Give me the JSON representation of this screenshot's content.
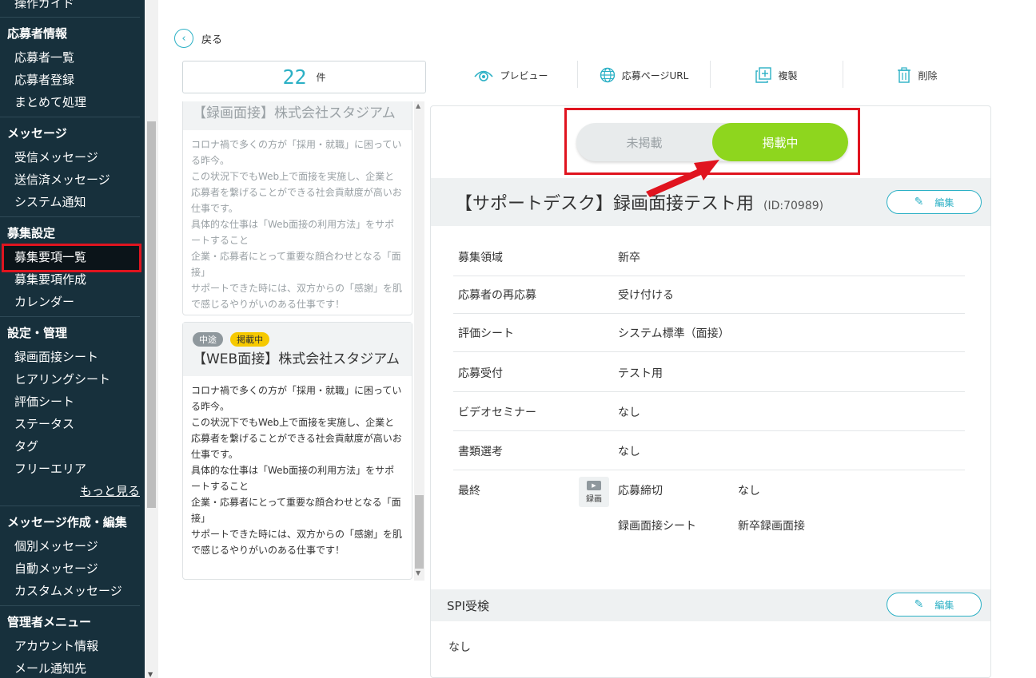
{
  "sidebar": {
    "top_item": "操作ガイド",
    "sections": [
      {
        "title": "応募者情報",
        "items": [
          "応募者一覧",
          "応募者登録",
          "まとめて処理"
        ]
      },
      {
        "title": "メッセージ",
        "items": [
          "受信メッセージ",
          "送信済メッセージ",
          "システム通知"
        ]
      },
      {
        "title": "募集設定",
        "items": [
          "募集要項一覧",
          "募集要項作成",
          "カレンダー"
        ]
      },
      {
        "title": "設定・管理",
        "items": [
          "録画面接シート",
          "ヒアリングシート",
          "評価シート",
          "ステータス",
          "タグ",
          "フリーエリア"
        ],
        "more": "もっと見る"
      },
      {
        "title": "メッセージ作成・編集",
        "items": [
          "個別メッセージ",
          "自動メッセージ",
          "カスタムメッセージ"
        ]
      },
      {
        "title": "管理者メニュー",
        "items": [
          "アカウント情報",
          "メール通知先"
        ]
      }
    ]
  },
  "back": {
    "label": "戻る"
  },
  "count": {
    "value": "22",
    "unit": "件"
  },
  "toolbar": {
    "preview": "プレビュー",
    "apply_url": "応募ページURL",
    "duplicate": "複製",
    "delete": "削除"
  },
  "cards": [
    {
      "title": "【録画面接】株式会社スタジアム",
      "body": [
        "コロナ禍で多くの方が「採用・就職」に困っている昨今。",
        "この状況下でもWeb上で面接を実施し、企業と応募者を繋げることができる社会貢献度が高いお仕事です。",
        "具体的な仕事は「Web面接の利用方法」をサポートすること",
        "企業・応募者にとって重要な顔合わせとなる「面接」",
        "サポートできた時には、双方からの「感謝」を肌で感じるやりがいのある仕事です！"
      ]
    },
    {
      "badges": [
        "中途",
        "掲載中"
      ],
      "title": "【WEB面接】株式会社スタジアム",
      "body": [
        "コロナ禍で多くの方が「採用・就職」に困っている昨今。",
        "この状況下でもWeb上で面接を実施し、企業と応募者を繋げることができる社会貢献度が高いお仕事です。",
        "具体的な仕事は「Web面接の利用方法」をサポートすること",
        "企業・応募者にとって重要な顔合わせとなる「面接」",
        "サポートできた時には、双方からの「感謝」を肌で感じるやりがいのある仕事です！"
      ]
    }
  ],
  "detail": {
    "toggle_off": "未掲載",
    "toggle_on": "掲載中",
    "title": "【サポートデスク】録画面接テスト用",
    "id_label": "(ID:70989)",
    "edit_label": "編集",
    "rows": [
      {
        "label": "募集領域",
        "value": "新卒"
      },
      {
        "label": "応募者の再応募",
        "value": "受け付ける"
      },
      {
        "label": "評価シート",
        "value": "システム標準（面接）"
      },
      {
        "label": "応募受付",
        "value": "テスト用"
      },
      {
        "label": "ビデオセミナー",
        "value": "なし"
      },
      {
        "label": "書類選考",
        "value": "なし"
      }
    ],
    "final": {
      "label": "最終",
      "icon_label": "録画",
      "sub": [
        {
          "label": "応募締切",
          "value": "なし"
        },
        {
          "label": "録画面接シート",
          "value": "新卒録画面接"
        }
      ]
    },
    "spi": {
      "title": "SPI受検",
      "edit_label": "編集",
      "value": "なし"
    }
  },
  "colors": {
    "accent": "#2bb0c5",
    "sidebar_bg": "#17303c",
    "toggle_on": "#8ed61e",
    "annotation": "#e0141f"
  }
}
